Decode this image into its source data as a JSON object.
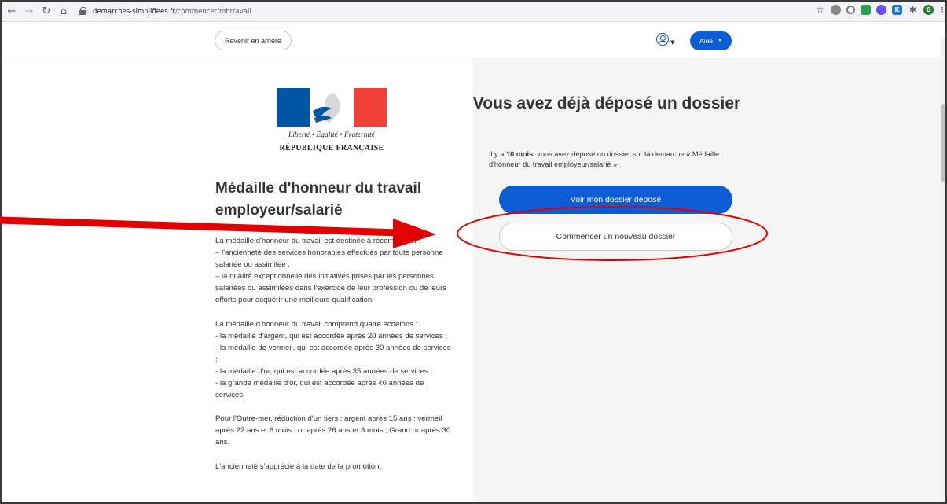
{
  "browser": {
    "url_host": "demarches-simplifiees.fr",
    "url_path": "/commencer/mhtravail",
    "ext_icons": [
      "star-icon",
      "extension-icon",
      "circle-icon",
      "green-square-icon",
      "purple-icon",
      "k-icon",
      "puzzle-icon",
      "profile-icon"
    ],
    "profile_initial": "G"
  },
  "header": {
    "back_label": "Revenir en arrière",
    "help_label": "Aide"
  },
  "logo": {
    "motto": "Liberté • Égalité • Fraternité",
    "republic": "RÉPUBLIQUE FRANÇAISE"
  },
  "procedure": {
    "title": "Médaille d'honneur du travail employeur/salarié",
    "paragraphs": [
      "La médaille d'honneur du travail est destinée à récompenser :\n– l'ancienneté des services honorables effectués par toute personne salariée ou assimilée ;\n– la qualité exceptionnelle des initiatives prises par les personnes salariées ou assimilées dans l'exercice de leur profession ou de leurs efforts pour acquérir une meilleure qualification.",
      "La médaille d'honneur du travail comprend quatre échelons :\n- la médaille d'argent, qui est accordée après 20 années de services ;\n- la médaille de vermeil, qui est accordée après 30 années de services ;\n- la médaille d'or, qui est accordée après 35 années de services ;\n- la grande médaille d'or, qui est accordée après 40 années de services.",
      "Pour l'Outre-mer, réduction d'un tiers : argent après 15 ans ; vermeil après 22 ans et 6 mois ; or après 26 ans et 3 mois ; Grand or après 30 ans.",
      "L'ancienneté s'apprécie à la date de la promotion."
    ]
  },
  "existing": {
    "title": "Vous avez déjà déposé un dossier",
    "text_before": "Il y a ",
    "text_bold": "10 mois",
    "text_after": ", vous avez déposé un dossier sur la démarche « Médaille d'honneur du travail employeur/salarié ».",
    "view_label": "Voir mon dossier déposé",
    "new_label": "Commencer un nouveau dossier"
  },
  "colors": {
    "primary": "#0b5cd5",
    "annotation_red": "#e00000",
    "right_panel_bg": "#f5f5f5"
  }
}
